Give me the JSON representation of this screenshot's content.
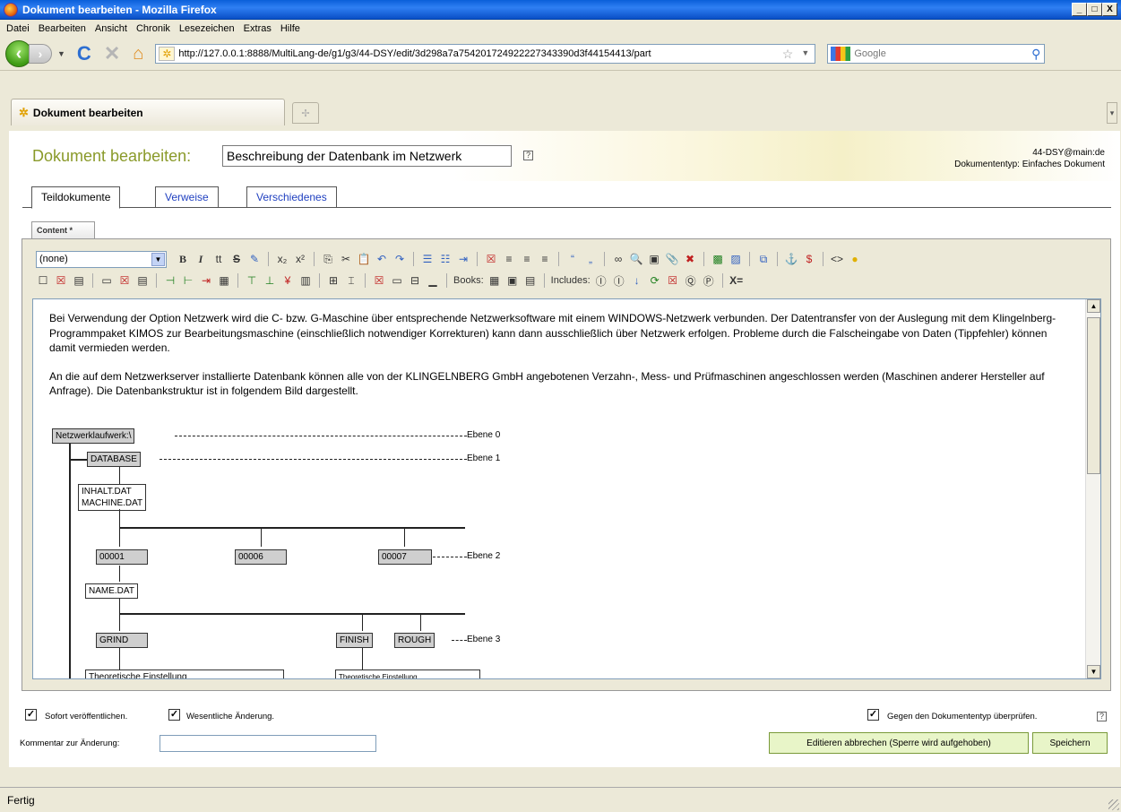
{
  "window": {
    "title": "Dokument bearbeiten - Mozilla Firefox",
    "minimize": "_",
    "maximize": "□",
    "close": "X"
  },
  "menu": [
    "Datei",
    "Bearbeiten",
    "Ansicht",
    "Chronik",
    "Lesezeichen",
    "Extras",
    "Hilfe"
  ],
  "nav": {
    "url": "http://127.0.0.1:8888/MultiLang-de/g1/g3/44-DSY/edit/3d298a7a754201724922227343390d3f44154413/part",
    "search_placeholder": "Google"
  },
  "tab": {
    "label": "Dokument bearbeiten"
  },
  "page": {
    "title_label": "Dokument bearbeiten:",
    "title_value": "Beschreibung der Datenbank im Netzwerk",
    "help": "?",
    "doc_id": "44-DSY@main:de",
    "doc_type": "Dokumententyp: Einfaches Dokument",
    "tabs": [
      "Teildokumente",
      "Verweise",
      "Verschiedenes"
    ],
    "subtab": "Content *"
  },
  "editor": {
    "format_select": "(none)",
    "books_label": "Books:",
    "includes_label": "Includes:",
    "paragraph1": "Bei Verwendung der Option Netzwerk wird die C- bzw. G-Maschine über entsprechende Netzwerksoftware mit einem WINDOWS-Netzwerk verbunden. Der Datentransfer von der Auslegung mit dem Klingelnberg-Programmpaket KIMOS zur Bearbeitungsmaschine (einschließlich notwendiger Korrekturen) kann dann ausschließlich über Netzwerk erfolgen. Probleme durch die Falscheingabe von Daten (Tippfehler) können damit vermieden werden.",
    "paragraph2": "An die auf dem Netzwerkserver installierte Datenbank können alle von der KLINGELNBERG GmbH angebotenen Verzahn-, Mess- und Prüfmaschinen angeschlossen werden (Maschinen anderer Hersteller auf Anfrage). Die Datenbankstruktur ist in folgendem Bild dargestellt."
  },
  "diagram": {
    "root": "Netzwerklaufwerk:\\",
    "database": "DATABASE",
    "files_line1": "INHALT.DAT",
    "files_line2": "MACHINE.DAT",
    "m1": "00001",
    "m2": "00006",
    "m3": "00007",
    "name_dat": "NAME.DAT",
    "grind": "GRIND",
    "finish": "FINISH",
    "rough": "ROUGH",
    "theory1": "Theoretische Einstellung",
    "theory2": "Theoretische Einstellung",
    "level0": "Ebene 0",
    "level1": "Ebene 1",
    "level2": "Ebene 2",
    "level3": "Ebene 3"
  },
  "bottom": {
    "publish": "Sofort veröffentlichen.",
    "major_change": "Wesentliche Änderung.",
    "validate": "Gegen den Dokumententyp überprüfen.",
    "comment_label": "Kommentar zur Änderung:",
    "cancel_btn": "Editieren abbrechen (Sperre wird aufgehoben)",
    "save_btn": "Speichern"
  },
  "status": "Fertig"
}
